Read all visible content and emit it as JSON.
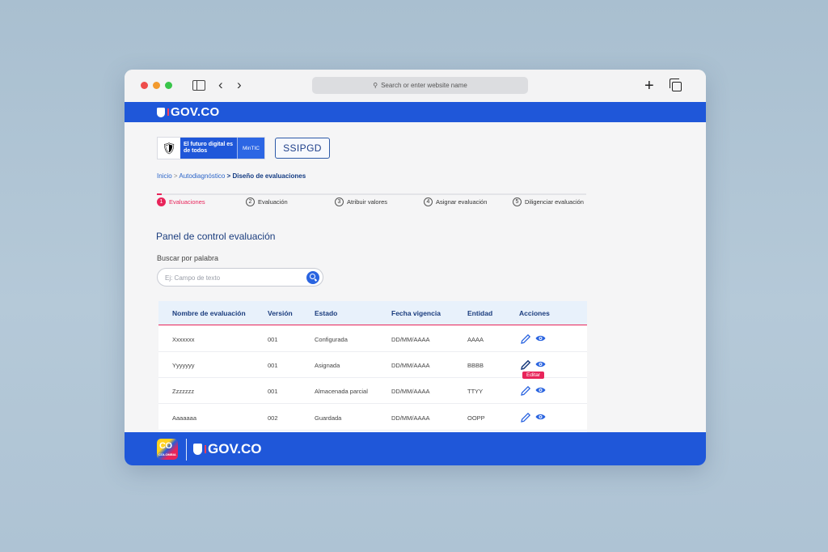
{
  "browser": {
    "url_placeholder": "Search or enter website name"
  },
  "gov_header": {
    "logo_text": "GOV.CO"
  },
  "brand": {
    "tagline": "El futuro digital es de todos",
    "entity": "MinTIC",
    "app_name": "SSIPGD"
  },
  "breadcrumb": {
    "items": [
      "Inicio",
      "Autodiagnóstico"
    ],
    "separator": ">",
    "current": "Diseño de evaluaciones"
  },
  "steps": [
    {
      "num": "1",
      "label": "Evaluaciones",
      "active": true
    },
    {
      "num": "2",
      "label": "Evaluación",
      "active": false
    },
    {
      "num": "3",
      "label": "Atribuir valores",
      "active": false
    },
    {
      "num": "4",
      "label": "Asignar evaluación",
      "active": false
    },
    {
      "num": "5",
      "label": "Diligenciar evaluación",
      "active": false
    }
  ],
  "panel": {
    "title": "Panel de control evaluación",
    "search_label": "Buscar por palabra",
    "search_placeholder": "Ej: Campo de texto"
  },
  "table": {
    "headers": [
      "Nombre de evaluación",
      "Versión",
      "Estado",
      "Fecha vigencia",
      "Entidad",
      "Acciones"
    ],
    "rows": [
      [
        "Xxxxxxx",
        "001",
        "Configurada",
        "DD/MM/AAAA",
        "AAAA"
      ],
      [
        "Yyyyyyy",
        "001",
        "Asignada",
        "DD/MM/AAAA",
        "BBBB"
      ],
      [
        "Zzzzzzz",
        "001",
        "Almacenada parcial",
        "DD/MM/AAAA",
        "TTYY"
      ],
      [
        "Aaaaaaa",
        "002",
        "Guardada",
        "DD/MM/AAAA",
        "OOPP"
      ]
    ],
    "tooltip": "Editar"
  },
  "footer": {
    "co_text": "CO",
    "co_subtext": "COLOMBIA",
    "logo_text": "GOV.CO"
  },
  "colors": {
    "gov_blue": "#1f57d9",
    "accent_pink": "#e8245a",
    "title_navy": "#1b3d7e"
  },
  "icons": [
    "sidebar-icon",
    "back-arrow-icon",
    "forward-arrow-icon",
    "search-icon",
    "plus-icon",
    "tabs-icon",
    "shield-icon",
    "escudo-icon",
    "edit-icon",
    "eye-icon"
  ]
}
